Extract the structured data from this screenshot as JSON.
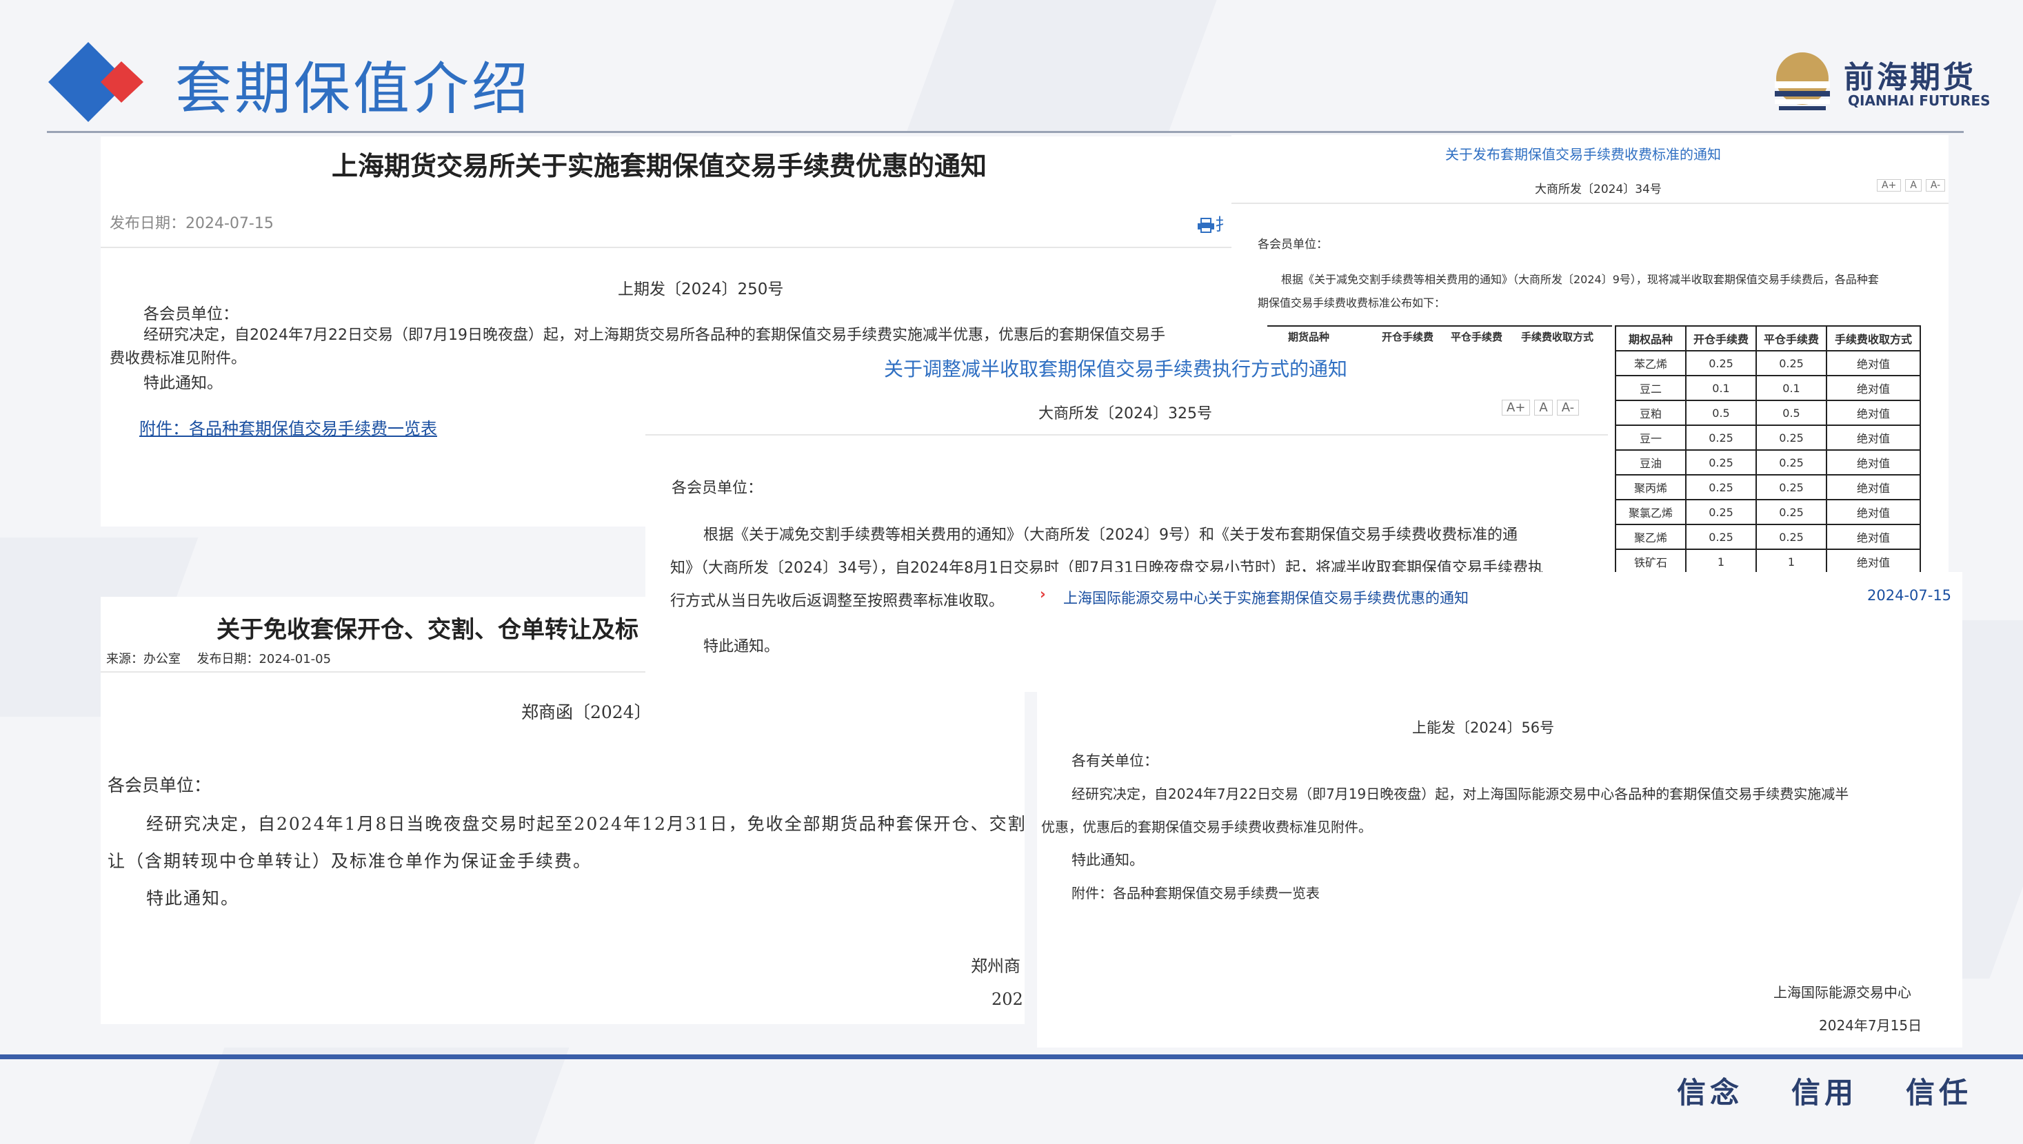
{
  "header": {
    "title": "套期保值介绍",
    "logo_cn": "前海期货",
    "logo_en": "QIANHAI FUTURES"
  },
  "footer": {
    "slogans": [
      "信念",
      "信用",
      "信任"
    ]
  },
  "doc_shfe": {
    "title": "上海期货交易所关于实施套期保值交易手续费优惠的通知",
    "date_label": "发布日期：",
    "date": "2024-07-15",
    "print_fragment": "扌",
    "ref": "上期发〔2024〕250号",
    "salutation": "各会员单位：",
    "body_line1": "经研究决定，自2024年7月22日交易（即7月19日晚夜盘）起，对上海期货交易所各品种的套期保值交易手续费实施减半优惠，优惠后的套期保值交易手",
    "body_line2": "费收费标准见附件。",
    "closing": "特此通知。",
    "attachment": "附件：各品种套期保值交易手续费一览表"
  },
  "doc_dce_34": {
    "title": "关于发布套期保值交易手续费收费标准的通知",
    "ref": "大商所发〔2024〕34号",
    "font_a_plus": "A+",
    "font_a": "A",
    "font_a_minus": "A-",
    "salutation": "各会员单位：",
    "body_line1": "根据《关于减免交割手续费等相关费用的通知》（大商所发〔2024〕9号），现将减半收取套期保值交易手续费后，各品种套",
    "body_line2": "期保值交易手续费收费标准公布如下：",
    "hidden_headers": [
      "期货品种",
      "开仓手续费",
      "平仓手续费",
      "手续费收取方式"
    ],
    "table": {
      "headers": [
        "期权品种",
        "开仓手续费",
        "平仓手续费",
        "手续费收取方式"
      ],
      "rows": [
        [
          "苯乙烯",
          "0.25",
          "0.25",
          "绝对值"
        ],
        [
          "豆二",
          "0.1",
          "0.1",
          "绝对值"
        ],
        [
          "豆粕",
          "0.5",
          "0.5",
          "绝对值"
        ],
        [
          "豆一",
          "0.25",
          "0.25",
          "绝对值"
        ],
        [
          "豆油",
          "0.25",
          "0.25",
          "绝对值"
        ],
        [
          "聚丙烯",
          "0.25",
          "0.25",
          "绝对值"
        ],
        [
          "聚氯乙烯",
          "0.25",
          "0.25",
          "绝对值"
        ],
        [
          "聚乙烯",
          "0.25",
          "0.25",
          "绝对值"
        ],
        [
          "铁矿石",
          "1",
          "1",
          "绝对值"
        ]
      ]
    }
  },
  "doc_dce_325": {
    "title": "关于调整减半收取套期保值交易手续费执行方式的通知",
    "ref": "大商所发〔2024〕325号",
    "font_a_plus": "A+",
    "font_a": "A",
    "font_a_minus": "A-",
    "salutation": "各会员单位：",
    "body_line1": "根据《关于减免交割手续费等相关费用的通知》（大商所发〔2024〕9号）和《关于发布套期保值交易手续费收费标准的通",
    "body_line2": "知》（大商所发〔2024〕34号），自2024年8月1日交易时（即7月31日晚夜盘交易小节时）起，将减半收取套期保值交易手续费执",
    "body_line3": "行方式从当日先收后返调整至按照费率标准收取。",
    "closing": "特此通知。"
  },
  "doc_czce": {
    "title": "关于免收套保开仓、交割、仓单转让及标",
    "source_label": "来源：",
    "source": "办公室",
    "date_label": "发布日期：",
    "date": "2024-01-05",
    "ref": "郑商函〔2024〕",
    "salutation": "各会员单位：",
    "body_line1": "经研究决定，自2024年1月8日当晚夜盘交易时起至2024年12月31日，免收全部期货品种套保开仓、交割",
    "body_line2": "让（含期转现中仓单转让）及标准仓单作为保证金手续费。",
    "closing": "特此通知。",
    "sign_org": "郑州商",
    "sign_date": "202"
  },
  "doc_ine": {
    "list_bullet": "›",
    "list_title": "上海国际能源交易中心关于实施套期保值交易手续费优惠的通知",
    "list_date": "2024-07-15",
    "ref": "上能发〔2024〕56号",
    "salutation": "各有关单位：",
    "body_line1": "经研究决定，自2024年7月22日交易（即7月19日晚夜盘）起，对上海国际能源交易中心各品种的套期保值交易手续费实施减半",
    "body_line2": "优惠，优惠后的套期保值交易手续费收费标准见附件。",
    "closing": "特此通知。",
    "attachment": "附件：各品种套期保值交易手续费一览表",
    "sign_org": "上海国际能源交易中心",
    "sign_date": "2024年7月15日"
  },
  "colors": {
    "brand_blue": "#2f6fc2",
    "diamond_blue": "#2a6bc5",
    "diamond_red": "#e43b3b",
    "logo_gold": "#c9a25a",
    "footer_line": "#3a5ea8"
  }
}
